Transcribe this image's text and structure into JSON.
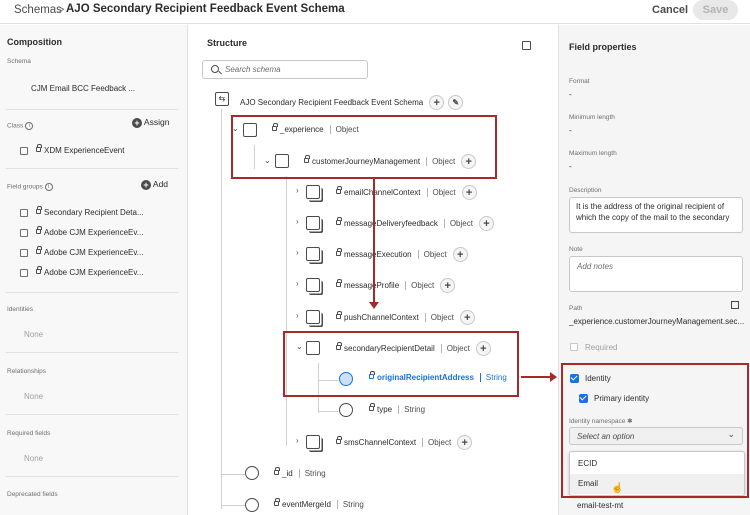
{
  "header": {
    "breadcrumb_root": "Schemas",
    "breadcrumb_sep": ">",
    "title": "AJO Secondary Recipient Feedback Event Schema",
    "cancel_label": "Cancel",
    "save_label": "Save"
  },
  "composition": {
    "heading": "Composition",
    "schema_label": "Schema",
    "schema_value": "CJM Email BCC Feedback ...",
    "class_label": "Class",
    "assign_label": "Assign",
    "class_item": "XDM ExperienceEvent",
    "field_groups_label": "Field groups",
    "add_label": "Add",
    "field_groups": [
      "Secondary Recipient Deta...",
      "Adobe CJM ExperienceEv...",
      "Adobe CJM ExperienceEv...",
      "Adobe CJM ExperienceEv..."
    ],
    "identities_label": "Identities",
    "identities_value": "None",
    "relationships_label": "Relationships",
    "relationships_value": "None",
    "required_label": "Required fields",
    "required_value": "None",
    "deprecated_label": "Deprecated fields"
  },
  "structure": {
    "heading": "Structure",
    "search_placeholder": "Search schema",
    "root": "AJO Secondary Recipient Feedback Event Schema",
    "nodes": {
      "experience": {
        "name": "_experience",
        "type": "Object"
      },
      "cjm": {
        "name": "customerJourneyManagement",
        "type": "Object"
      },
      "email": {
        "name": "emailChannelContext",
        "type": "Object"
      },
      "delivery": {
        "name": "messageDeliveryfeedback",
        "type": "Object"
      },
      "execution": {
        "name": "messageExecution",
        "type": "Object"
      },
      "profile": {
        "name": "messageProfile",
        "type": "Object"
      },
      "push": {
        "name": "pushChannelContext",
        "type": "Object"
      },
      "secondary": {
        "name": "secondaryRecipientDetail",
        "type": "Object"
      },
      "original": {
        "name": "originalRecipientAddress",
        "type": "String"
      },
      "typefield": {
        "name": "type",
        "type": "String"
      },
      "sms": {
        "name": "smsChannelContext",
        "type": "Object"
      },
      "id": {
        "name": "_id",
        "type": "String"
      },
      "merge": {
        "name": "eventMergeId",
        "type": "String"
      }
    }
  },
  "properties": {
    "heading": "Field properties",
    "format_label": "Format",
    "format_value": "-",
    "minlen_label": "Minimum length",
    "minlen_value": "-",
    "maxlen_label": "Maximum length",
    "maxlen_value": "-",
    "description_label": "Description",
    "description_value": "It is the address of the original recipient of which the copy of the mail to the secondary",
    "note_label": "Note",
    "note_placeholder": "Add notes",
    "path_label": "Path",
    "path_value": "_experience.customerJourneyManagement.sec...",
    "required_label": "Required",
    "identity_label": "Identity",
    "primary_identity_label": "Primary identity",
    "namespace_label": "Identity namespace",
    "namespace_placeholder": "Select an option",
    "namespace_options": [
      "ECID",
      "Email"
    ],
    "bottom_value": "email-test-mt"
  },
  "colors": {
    "accent": "#1473e6",
    "highlight_box": "#a52a2a"
  }
}
